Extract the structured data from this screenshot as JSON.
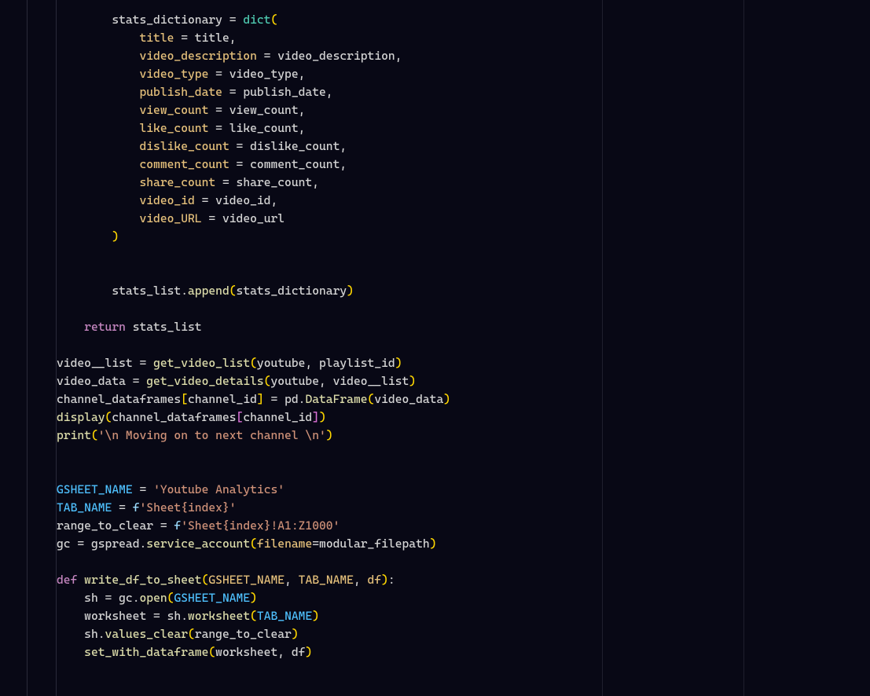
{
  "tokens": {
    "stats_dictionary": "stats_dictionary",
    "dict": "dict",
    "title": "title",
    "video_description": "video_description",
    "video_type": "video_type",
    "publish_date": "publish_date",
    "view_count": "view_count",
    "like_count": "like_count",
    "dislike_count": "dislike_count",
    "comment_count": "comment_count",
    "share_count": "share_count",
    "video_id": "video_id",
    "video_URL": "video_URL",
    "video_url": "video_url",
    "stats_list": "stats_list",
    "append": "append",
    "return": "return",
    "video__list": "video__list",
    "get_video_list": "get_video_list",
    "youtube": "youtube",
    "playlist_id": "playlist_id",
    "video_data": "video_data",
    "get_video_details": "get_video_details",
    "channel_dataframes": "channel_dataframes",
    "channel_id": "channel_id",
    "pd": "pd",
    "DataFrame": "DataFrame",
    "display": "display",
    "print": "print",
    "print_str": "'\\n Moving on to next channel \\n'",
    "GSHEET_NAME": "GSHEET_NAME",
    "gsheet_val": "'Youtube Analytics'",
    "TAB_NAME": "TAB_NAME",
    "f": "f",
    "sheet_index": "'Sheet{index}'",
    "range_to_clear": "range_to_clear",
    "range_val": "'Sheet{index}!A1:Z1000'",
    "gc": "gc",
    "gspread": "gspread",
    "service_account": "service_account",
    "filename": "filename",
    "modular_filepath": "modular_filepath",
    "def": "def",
    "write_df_to_sheet": "write_df_to_sheet",
    "df": "df",
    "sh": "sh",
    "open": "open",
    "worksheet": "worksheet",
    "values_clear": "values_clear",
    "set_with_dataframe": "set_with_dataframe",
    "eq": " = ",
    "eq_nospace": "=",
    "comma": ","
  }
}
